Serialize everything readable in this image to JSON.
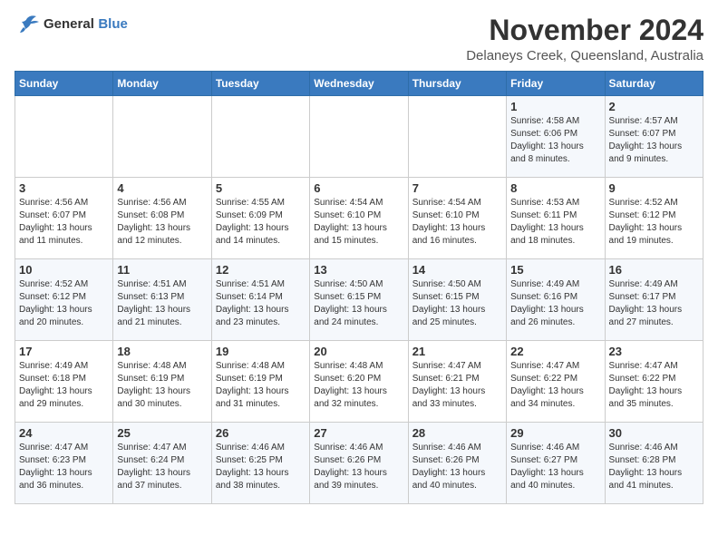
{
  "logo": {
    "general": "General",
    "blue": "Blue"
  },
  "title": "November 2024",
  "subtitle": "Delaneys Creek, Queensland, Australia",
  "days_of_week": [
    "Sunday",
    "Monday",
    "Tuesday",
    "Wednesday",
    "Thursday",
    "Friday",
    "Saturday"
  ],
  "weeks": [
    [
      {
        "day": "",
        "info": ""
      },
      {
        "day": "",
        "info": ""
      },
      {
        "day": "",
        "info": ""
      },
      {
        "day": "",
        "info": ""
      },
      {
        "day": "",
        "info": ""
      },
      {
        "day": "1",
        "info": "Sunrise: 4:58 AM\nSunset: 6:06 PM\nDaylight: 13 hours\nand 8 minutes."
      },
      {
        "day": "2",
        "info": "Sunrise: 4:57 AM\nSunset: 6:07 PM\nDaylight: 13 hours\nand 9 minutes."
      }
    ],
    [
      {
        "day": "3",
        "info": "Sunrise: 4:56 AM\nSunset: 6:07 PM\nDaylight: 13 hours\nand 11 minutes."
      },
      {
        "day": "4",
        "info": "Sunrise: 4:56 AM\nSunset: 6:08 PM\nDaylight: 13 hours\nand 12 minutes."
      },
      {
        "day": "5",
        "info": "Sunrise: 4:55 AM\nSunset: 6:09 PM\nDaylight: 13 hours\nand 14 minutes."
      },
      {
        "day": "6",
        "info": "Sunrise: 4:54 AM\nSunset: 6:10 PM\nDaylight: 13 hours\nand 15 minutes."
      },
      {
        "day": "7",
        "info": "Sunrise: 4:54 AM\nSunset: 6:10 PM\nDaylight: 13 hours\nand 16 minutes."
      },
      {
        "day": "8",
        "info": "Sunrise: 4:53 AM\nSunset: 6:11 PM\nDaylight: 13 hours\nand 18 minutes."
      },
      {
        "day": "9",
        "info": "Sunrise: 4:52 AM\nSunset: 6:12 PM\nDaylight: 13 hours\nand 19 minutes."
      }
    ],
    [
      {
        "day": "10",
        "info": "Sunrise: 4:52 AM\nSunset: 6:12 PM\nDaylight: 13 hours\nand 20 minutes."
      },
      {
        "day": "11",
        "info": "Sunrise: 4:51 AM\nSunset: 6:13 PM\nDaylight: 13 hours\nand 21 minutes."
      },
      {
        "day": "12",
        "info": "Sunrise: 4:51 AM\nSunset: 6:14 PM\nDaylight: 13 hours\nand 23 minutes."
      },
      {
        "day": "13",
        "info": "Sunrise: 4:50 AM\nSunset: 6:15 PM\nDaylight: 13 hours\nand 24 minutes."
      },
      {
        "day": "14",
        "info": "Sunrise: 4:50 AM\nSunset: 6:15 PM\nDaylight: 13 hours\nand 25 minutes."
      },
      {
        "day": "15",
        "info": "Sunrise: 4:49 AM\nSunset: 6:16 PM\nDaylight: 13 hours\nand 26 minutes."
      },
      {
        "day": "16",
        "info": "Sunrise: 4:49 AM\nSunset: 6:17 PM\nDaylight: 13 hours\nand 27 minutes."
      }
    ],
    [
      {
        "day": "17",
        "info": "Sunrise: 4:49 AM\nSunset: 6:18 PM\nDaylight: 13 hours\nand 29 minutes."
      },
      {
        "day": "18",
        "info": "Sunrise: 4:48 AM\nSunset: 6:19 PM\nDaylight: 13 hours\nand 30 minutes."
      },
      {
        "day": "19",
        "info": "Sunrise: 4:48 AM\nSunset: 6:19 PM\nDaylight: 13 hours\nand 31 minutes."
      },
      {
        "day": "20",
        "info": "Sunrise: 4:48 AM\nSunset: 6:20 PM\nDaylight: 13 hours\nand 32 minutes."
      },
      {
        "day": "21",
        "info": "Sunrise: 4:47 AM\nSunset: 6:21 PM\nDaylight: 13 hours\nand 33 minutes."
      },
      {
        "day": "22",
        "info": "Sunrise: 4:47 AM\nSunset: 6:22 PM\nDaylight: 13 hours\nand 34 minutes."
      },
      {
        "day": "23",
        "info": "Sunrise: 4:47 AM\nSunset: 6:22 PM\nDaylight: 13 hours\nand 35 minutes."
      }
    ],
    [
      {
        "day": "24",
        "info": "Sunrise: 4:47 AM\nSunset: 6:23 PM\nDaylight: 13 hours\nand 36 minutes."
      },
      {
        "day": "25",
        "info": "Sunrise: 4:47 AM\nSunset: 6:24 PM\nDaylight: 13 hours\nand 37 minutes."
      },
      {
        "day": "26",
        "info": "Sunrise: 4:46 AM\nSunset: 6:25 PM\nDaylight: 13 hours\nand 38 minutes."
      },
      {
        "day": "27",
        "info": "Sunrise: 4:46 AM\nSunset: 6:26 PM\nDaylight: 13 hours\nand 39 minutes."
      },
      {
        "day": "28",
        "info": "Sunrise: 4:46 AM\nSunset: 6:26 PM\nDaylight: 13 hours\nand 40 minutes."
      },
      {
        "day": "29",
        "info": "Sunrise: 4:46 AM\nSunset: 6:27 PM\nDaylight: 13 hours\nand 40 minutes."
      },
      {
        "day": "30",
        "info": "Sunrise: 4:46 AM\nSunset: 6:28 PM\nDaylight: 13 hours\nand 41 minutes."
      }
    ]
  ]
}
